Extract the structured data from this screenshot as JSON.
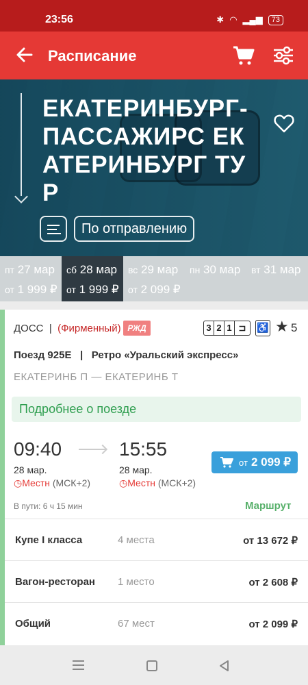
{
  "status": {
    "time": "23:56",
    "battery": "73"
  },
  "appbar": {
    "title": "Расписание"
  },
  "hero": {
    "route": "ЕКАТЕРИНБУРГ-ПАССАЖИРС ЕКАТЕРИНБУРГ ТУР",
    "sort_label": "По отправлению"
  },
  "dates": [
    {
      "dow": "пт",
      "date": "27 мар",
      "from": "от",
      "price": "1 999 ₽",
      "selected": false
    },
    {
      "dow": "сб",
      "date": "28 мар",
      "from": "от",
      "price": "1 999 ₽",
      "selected": true
    },
    {
      "dow": "вс",
      "date": "29 мар",
      "from": "от",
      "price": "2 099 ₽",
      "selected": false
    },
    {
      "dow": "пн",
      "date": "30 мар",
      "from": "",
      "price": "",
      "selected": false
    },
    {
      "dow": "вт",
      "date": "31 мар",
      "from": "",
      "price": "",
      "selected": false
    }
  ],
  "train": {
    "carrier": "ДОСС",
    "separator": "|",
    "brand": "(Фирменный)",
    "rzd_logo": "РЖД",
    "classes": [
      "3",
      "2",
      "1"
    ],
    "rating": "5",
    "number": "Поезд 925Е",
    "name": "Ретро «Уральский экспресс»",
    "route": "ЕКАТЕРИНБ П — ЕКАТЕРИНБ Т",
    "details_label": "Подробнее о поезде",
    "departure": {
      "time": "09:40",
      "date": "28 мар.",
      "tz_local": "Местн",
      "tz_msk": "(МСК+2)"
    },
    "arrival": {
      "time": "15:55",
      "date": "28 мар.",
      "tz_local": "Местн",
      "tz_msk": "(МСК+2)"
    },
    "price_from": "от",
    "price": "2 099 ₽",
    "travel_time": "В пути: 6 ч 15 мин",
    "route_link": "Маршрут"
  },
  "seats": [
    {
      "name": "Купе I класса",
      "count": "4 места",
      "price": "от 13 672 ₽"
    },
    {
      "name": "Вагон-ресторан",
      "count": "1 место",
      "price": "от 2 608 ₽"
    },
    {
      "name": "Общий",
      "count": "67 мест",
      "price": "от 2 099 ₽"
    }
  ],
  "icons": [
    "back-arrow-icon",
    "cart-icon",
    "filter-icon",
    "heart-icon",
    "sort-icon",
    "wheelchair-icon",
    "star-icon",
    "clock-icon"
  ]
}
